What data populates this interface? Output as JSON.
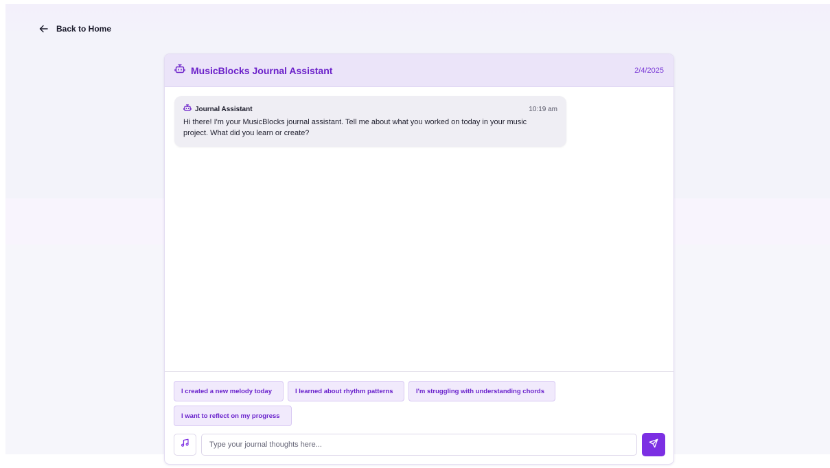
{
  "nav": {
    "back_label": "Back to Home"
  },
  "header": {
    "title": "MusicBlocks Journal Assistant",
    "date": "2/4/2025"
  },
  "messages": [
    {
      "sender": "Journal Assistant",
      "time": "10:19 am",
      "text": "Hi there! I'm your MusicBlocks journal assistant. Tell me about what you worked on today in your music project. What did you learn or create?"
    }
  ],
  "suggestions": [
    {
      "label": "I created a new melody today"
    },
    {
      "label": "I learned about rhythm patterns"
    },
    {
      "label": "I'm struggling with understanding chords"
    },
    {
      "label": "I want to reflect on my progress"
    }
  ],
  "composer": {
    "placeholder": "Type your journal thoughts here...",
    "value": ""
  },
  "colors": {
    "accent": "#7c2fe3",
    "header_bg": "#ebe4f9",
    "title": "#6a1fc9"
  },
  "icons": {
    "back": "arrow-left-icon",
    "bot": "bot-icon",
    "music": "music-note-icon",
    "send": "send-icon"
  }
}
